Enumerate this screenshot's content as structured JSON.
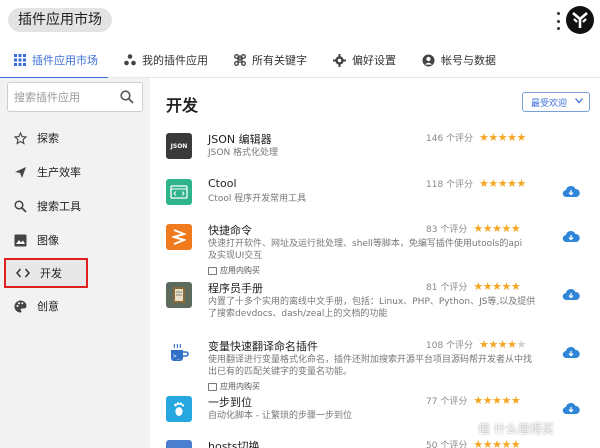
{
  "window": {
    "title": "插件应用市场"
  },
  "tabs": [
    {
      "label": "插件应用市场",
      "icon": "grid-icon"
    },
    {
      "label": "我的插件应用",
      "icon": "apps-icon"
    },
    {
      "label": "所有关键字",
      "icon": "command-icon"
    },
    {
      "label": "偏好设置",
      "icon": "gear-icon"
    },
    {
      "label": "帐号与数据",
      "icon": "account-icon"
    }
  ],
  "sidebar": {
    "search_placeholder": "搜索插件应用",
    "items": [
      {
        "label": "探索",
        "icon": "star-outline-icon"
      },
      {
        "label": "生产效率",
        "icon": "send-icon"
      },
      {
        "label": "搜索工具",
        "icon": "search-icon"
      },
      {
        "label": "图像",
        "icon": "image-icon"
      },
      {
        "label": "开发",
        "icon": "code-icon",
        "selected": true
      },
      {
        "label": "创意",
        "icon": "palette-icon"
      }
    ]
  },
  "main": {
    "section_title": "开发",
    "sort_label": "最受欢迎",
    "plugins": [
      {
        "name": "JSON 编辑器",
        "desc": "JSON 格式化处理",
        "tag": "",
        "rating": "146 个评分",
        "stars": 5,
        "icon_text": "JSON",
        "color": "#3a3a3a",
        "download": false
      },
      {
        "name": "Ctool",
        "desc": "Ctool 程序开发常用工具",
        "tag": "",
        "rating": "118 个评分",
        "stars": 5,
        "icon_text": "</>",
        "color": "#2fb38a",
        "download": true
      },
      {
        "name": "快捷命令",
        "desc": "快速打开软件、网址及运行批处理、shell等脚本，免编写插件使用utools的api及实现UI交互",
        "tag": "应用内购买",
        "rating": "83 个评分",
        "stars": 5,
        "icon_text": "",
        "color": "#f07a1c",
        "download": true
      },
      {
        "name": "程序员手册",
        "desc": "内置了十多个实用的离线中文手册，包括：Linux、PHP、Python、JS等,以及提供了搜索devdocs、dash/zeal上的文档的功能",
        "tag": "",
        "rating": "81 个评分",
        "stars": 5,
        "icon_text": "",
        "color": "#5d6b5d",
        "download": true
      },
      {
        "name": "变量快速翻译命名插件",
        "desc": "使用翻译进行变量格式化命名，插件还附加搜索开源平台项目源码帮开发者从中找出已有的匹配关键字的变量名功能。",
        "tag": "应用内购买",
        "rating": "108 个评分",
        "stars": 4,
        "icon_text": "",
        "color": "#ffffff",
        "download": true
      },
      {
        "name": "一步到位",
        "desc": "自动化脚本 - 让繁琐的步骤一步到位",
        "tag": "",
        "rating": "77 个评分",
        "stars": 5,
        "icon_text": "",
        "color": "#27a7e0",
        "download": true
      },
      {
        "name": "hosts切换",
        "desc": "",
        "tag": "",
        "rating": "50 个评分",
        "stars": 5,
        "icon_text": "",
        "color": "#4a7fd0",
        "download": false
      }
    ]
  },
  "watermark": "值 什么值得买"
}
